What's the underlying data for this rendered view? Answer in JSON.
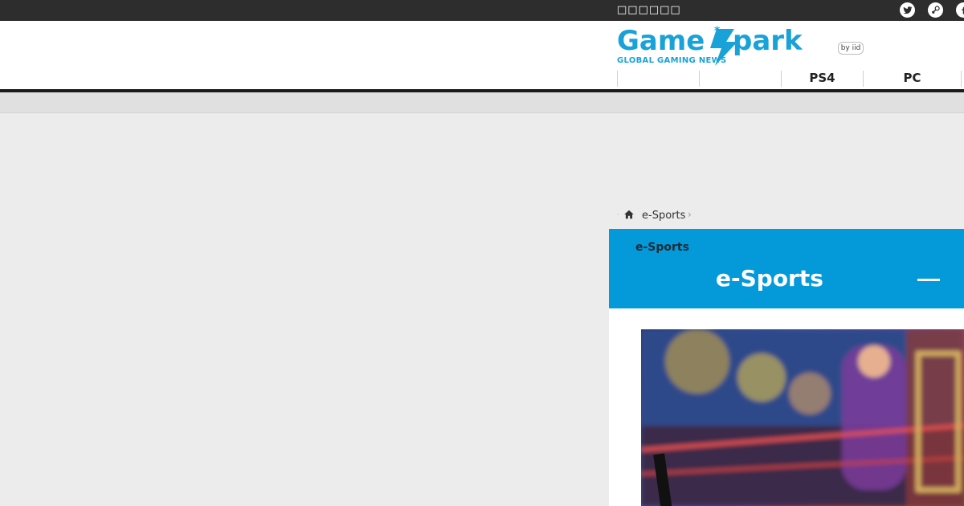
{
  "topbar": {
    "text": "□□□□□□"
  },
  "logo": {
    "name": "GameSpark",
    "tagline": "GLOBAL GAMING NEWS",
    "by": "by iid"
  },
  "nav": {
    "items": [
      "",
      "",
      "PS4",
      "PC"
    ]
  },
  "breadcrumb": {
    "label": "e-Sports"
  },
  "banner": {
    "small": "e-Sports",
    "title": "e-Sports"
  },
  "social": [
    "twitter-icon",
    "steam-icon",
    "facebook-icon"
  ]
}
